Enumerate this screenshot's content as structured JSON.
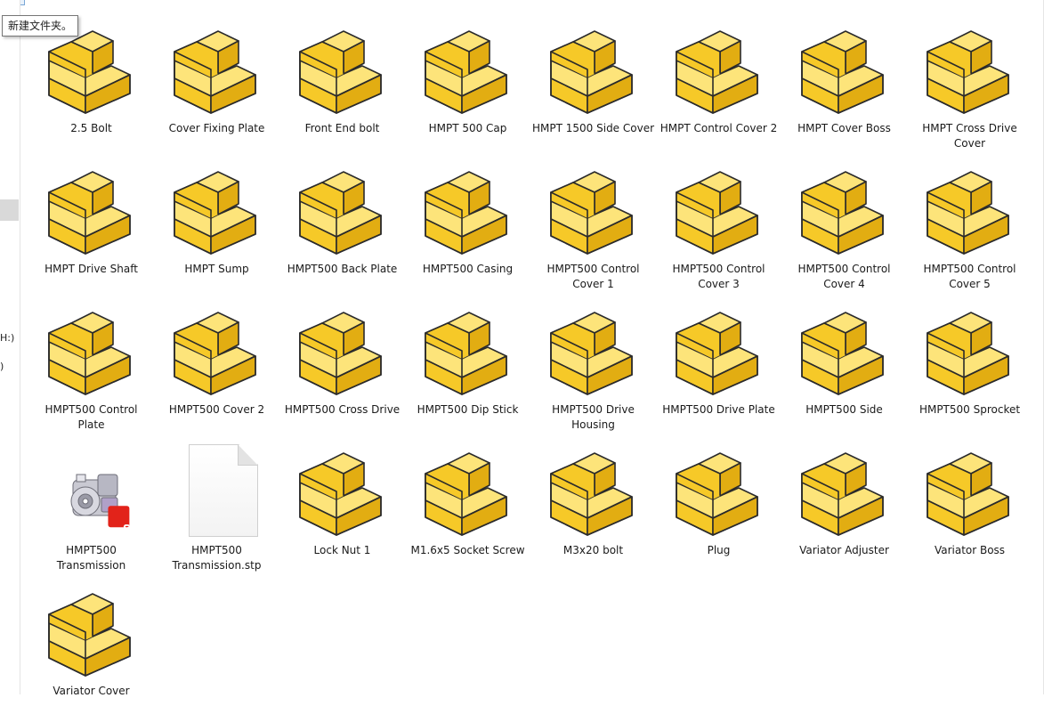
{
  "tooltip": "新建文件夹。",
  "nav_fragments": [
    "H:)",
    ")"
  ],
  "files": [
    {
      "name": "2.5 Bolt",
      "icon": "solidworks-part-icon"
    },
    {
      "name": "Cover Fixing Plate",
      "icon": "solidworks-part-icon"
    },
    {
      "name": "Front End bolt",
      "icon": "solidworks-part-icon"
    },
    {
      "name": "HMPT 500 Cap",
      "icon": "solidworks-part-icon"
    },
    {
      "name": "HMPT 1500 Side Cover",
      "icon": "solidworks-part-icon"
    },
    {
      "name": "HMPT Control Cover 2",
      "icon": "solidworks-part-icon"
    },
    {
      "name": "HMPT Cover Boss",
      "icon": "solidworks-part-icon"
    },
    {
      "name": "HMPT Cross Drive Cover",
      "icon": "solidworks-part-icon"
    },
    {
      "name": "HMPT Drive Shaft",
      "icon": "solidworks-part-icon"
    },
    {
      "name": "HMPT Sump",
      "icon": "solidworks-part-icon"
    },
    {
      "name": "HMPT500 Back Plate",
      "icon": "solidworks-part-icon"
    },
    {
      "name": "HMPT500 Casing",
      "icon": "solidworks-part-icon"
    },
    {
      "name": "HMPT500 Control Cover 1",
      "icon": "solidworks-part-icon"
    },
    {
      "name": "HMPT500 Control Cover 3",
      "icon": "solidworks-part-icon"
    },
    {
      "name": "HMPT500 Control Cover 4",
      "icon": "solidworks-part-icon"
    },
    {
      "name": "HMPT500 Control Cover 5",
      "icon": "solidworks-part-icon"
    },
    {
      "name": "HMPT500 Control Plate",
      "icon": "solidworks-part-icon"
    },
    {
      "name": "HMPT500 Cover 2",
      "icon": "solidworks-part-icon"
    },
    {
      "name": "HMPT500 Cross Drive",
      "icon": "solidworks-part-icon"
    },
    {
      "name": "HMPT500 Dip Stick",
      "icon": "solidworks-part-icon"
    },
    {
      "name": "HMPT500 Drive Housing",
      "icon": "solidworks-part-icon"
    },
    {
      "name": "HMPT500 Drive Plate",
      "icon": "solidworks-part-icon"
    },
    {
      "name": "HMPT500 Side",
      "icon": "solidworks-part-icon"
    },
    {
      "name": "HMPT500 Sprocket",
      "icon": "solidworks-part-icon"
    },
    {
      "name": "HMPT500 Transmission",
      "icon": "solidworks-assembly-icon"
    },
    {
      "name": "HMPT500 Transmission.stp",
      "icon": "generic-file-icon"
    },
    {
      "name": "Lock Nut 1",
      "icon": "solidworks-part-icon"
    },
    {
      "name": "M1.6x5 Socket Screw",
      "icon": "solidworks-part-icon"
    },
    {
      "name": "M3x20 bolt",
      "icon": "solidworks-part-icon"
    },
    {
      "name": "Plug",
      "icon": "solidworks-part-icon"
    },
    {
      "name": "Variator Adjuster",
      "icon": "solidworks-part-icon"
    },
    {
      "name": "Variator Boss",
      "icon": "solidworks-part-icon"
    },
    {
      "name": "Variator Cover",
      "icon": "solidworks-part-icon"
    }
  ],
  "colors": {
    "part_front": "#f6c928",
    "part_top": "#fde47a",
    "part_side": "#e2ad12",
    "part_edge": "#2b2b2b",
    "sw_badge": "#e2231a"
  }
}
